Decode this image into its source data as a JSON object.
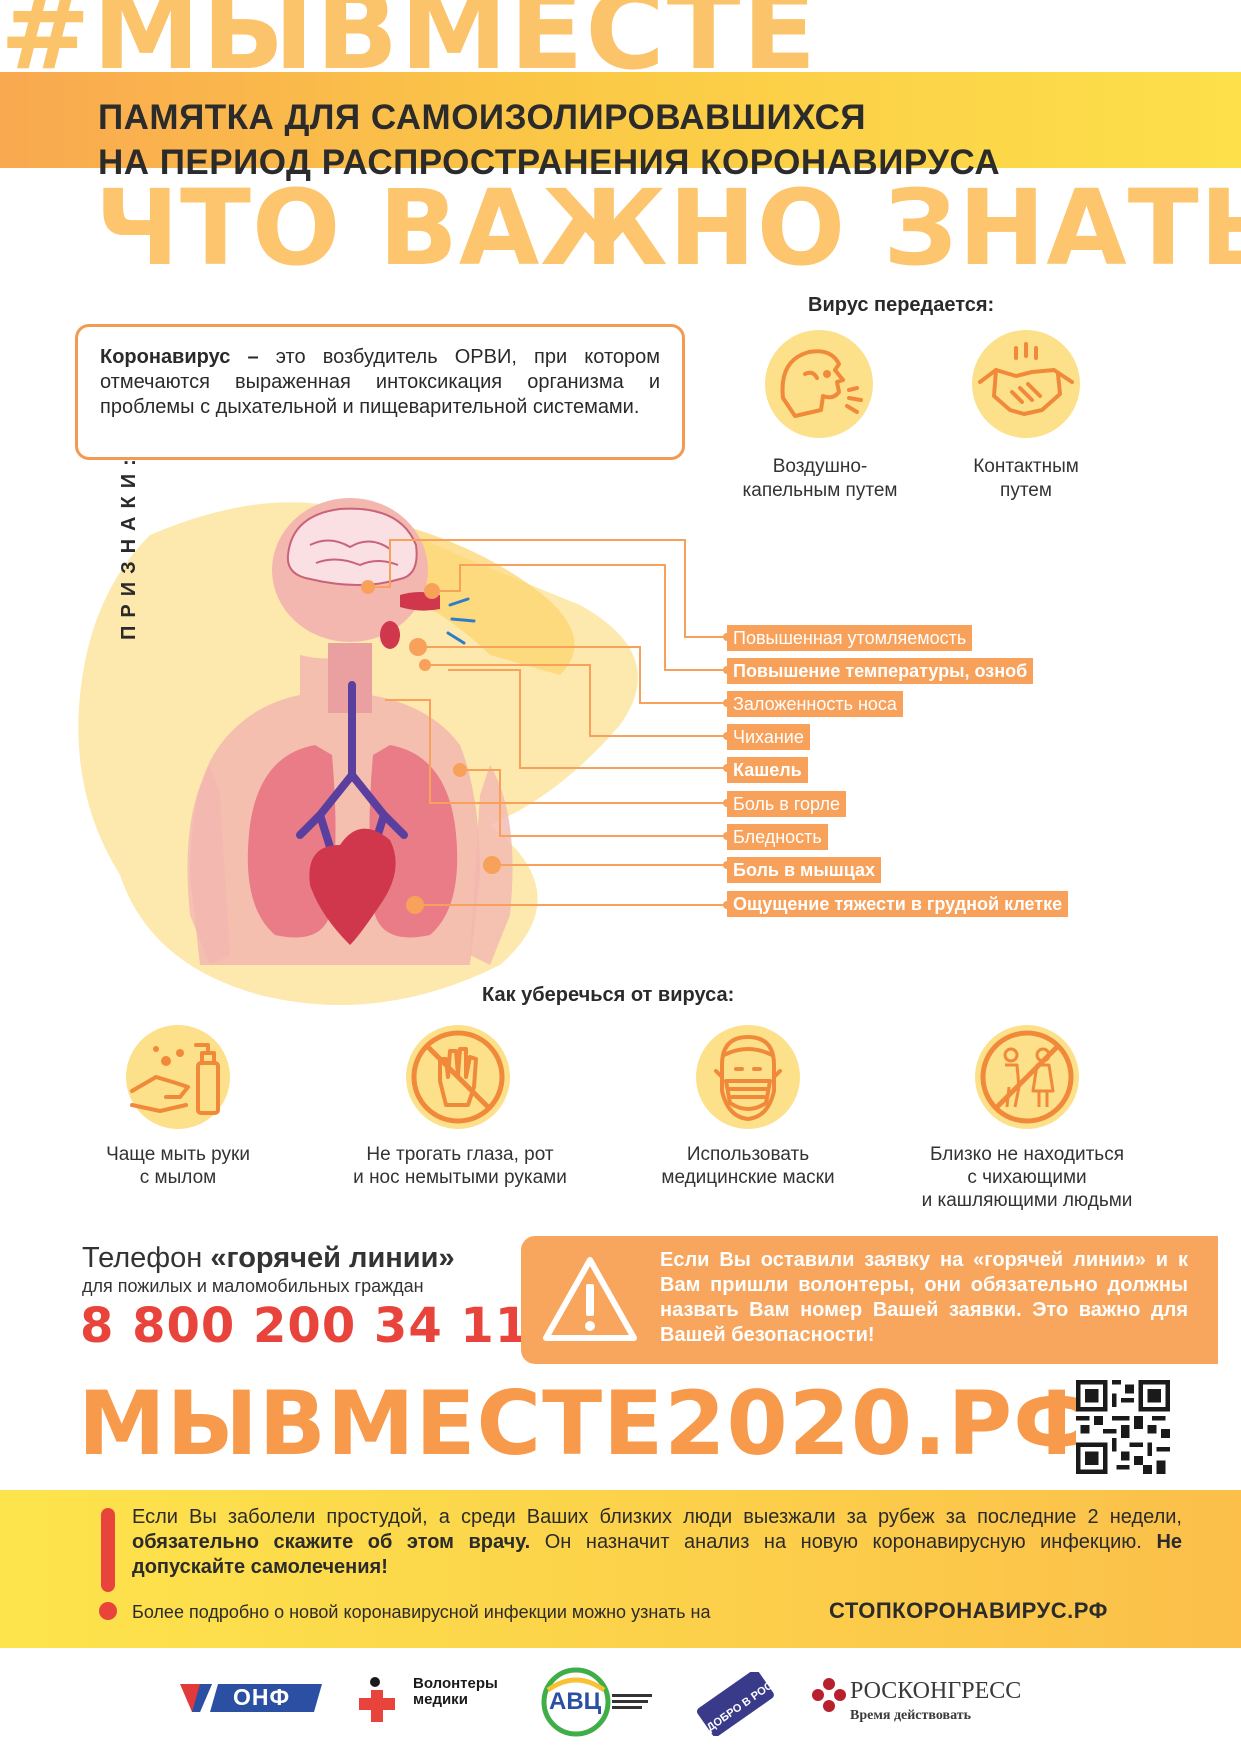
{
  "header": {
    "hashtag": "#МЫВМЕСТЕ",
    "subtitle_line1": "ПАМЯТКА ДЛЯ САМОИЗОЛИРОВАВШИХСЯ",
    "subtitle_line2": "НА ПЕРИОД РАСПРОСТРАНЕНИЯ КОРОНАВИРУСА",
    "heading": "ЧТО ВАЖНО ЗНАТЬ"
  },
  "definition": {
    "term": "Коронавирус –",
    "text": " это возбудитель ОРВИ, при котором отмечаются выраженная интоксикация организма и проблемы с дыхательной и пищеварительной системами."
  },
  "transmission": {
    "title": "Вирус передается:",
    "items": [
      {
        "line1": "Воздушно-",
        "line2": "капельным путем",
        "icon": "coughing-person-icon"
      },
      {
        "line1": "Контактным",
        "line2": "путем",
        "icon": "handshake-icon"
      }
    ]
  },
  "symptoms": {
    "label": "ПРИЗНАКИ:",
    "items": [
      {
        "text": "Повышенная утомляемость",
        "bold": false
      },
      {
        "text": "Повышение температуры, озноб",
        "bold": true
      },
      {
        "text": "Заложенность носа",
        "bold": false
      },
      {
        "text": "Чихание",
        "bold": false
      },
      {
        "text": "Кашель",
        "bold": true
      },
      {
        "text": "Боль в горле",
        "bold": false
      },
      {
        "text": "Бледность",
        "bold": false
      },
      {
        "text": "Боль в мышцах",
        "bold": true
      },
      {
        "text": "Ощущение тяжести в грудной клетке",
        "bold": true
      }
    ]
  },
  "prevention": {
    "title": "Как уберечься от вируса:",
    "items": [
      {
        "line1": "Чаще мыть руки",
        "line2": "с мылом",
        "line3": "",
        "icon": "hand-washing-icon"
      },
      {
        "line1": "Не трогать глаза, рот",
        "line2": "и нос немытыми руками",
        "line3": "",
        "icon": "no-touch-hand-icon"
      },
      {
        "line1": "Использовать",
        "line2": "медицинские маски",
        "line3": "",
        "icon": "face-mask-icon"
      },
      {
        "line1": "Близко не находиться",
        "line2": "с чихающими",
        "line3": "и кашляющими людьми",
        "icon": "keep-distance-icon"
      }
    ]
  },
  "hotline": {
    "title_prefix": "Телефон ",
    "title_bold": "«горячей линии»",
    "subtitle": "для пожилых и маломобильных граждан",
    "phone": "8 800 200 34 11"
  },
  "warning": {
    "text": "Если Вы оставили заявку на «горячей линии» и к Вам пришли волонтеры, они обязательно должны назвать Вам номер Вашей заявки. Это важно для Вашей безопасности!",
    "icon": "warning-triangle-icon"
  },
  "site": {
    "url": "МЫВМЕСТЕ2020.РФ"
  },
  "bottom": {
    "text_part1": "Если Вы заболели простудой, а среди Ваших близких люди выезжали за рубеж за последние 2 недели, ",
    "text_bold1": "обязательно скажите об этом врачу.",
    "text_part2": " Он назначит анализ на новую коронавирусную инфекцию. ",
    "text_bold2": "Не допускайте самолечения!",
    "more_info": "Более подробно о новой коронавирусной инфекции можно узнать на",
    "more_site": "СТОПКОРОНАВИРУС.РФ"
  },
  "logos": {
    "onf": "ОНФ",
    "volunteers_line1": "Волонтеры",
    "volunteers_line2": "медики",
    "avc": "АВЦ",
    "dobro": "ДОБРО В РОССИИ",
    "roscongress": "РОСКОНГРЕСС",
    "roscongress_tagline": "Время действовать"
  },
  "colors": {
    "orange": "#f7a15b",
    "yellow": "#fde04a",
    "red": "#e8443b",
    "peach_text": "#fcc56e"
  }
}
